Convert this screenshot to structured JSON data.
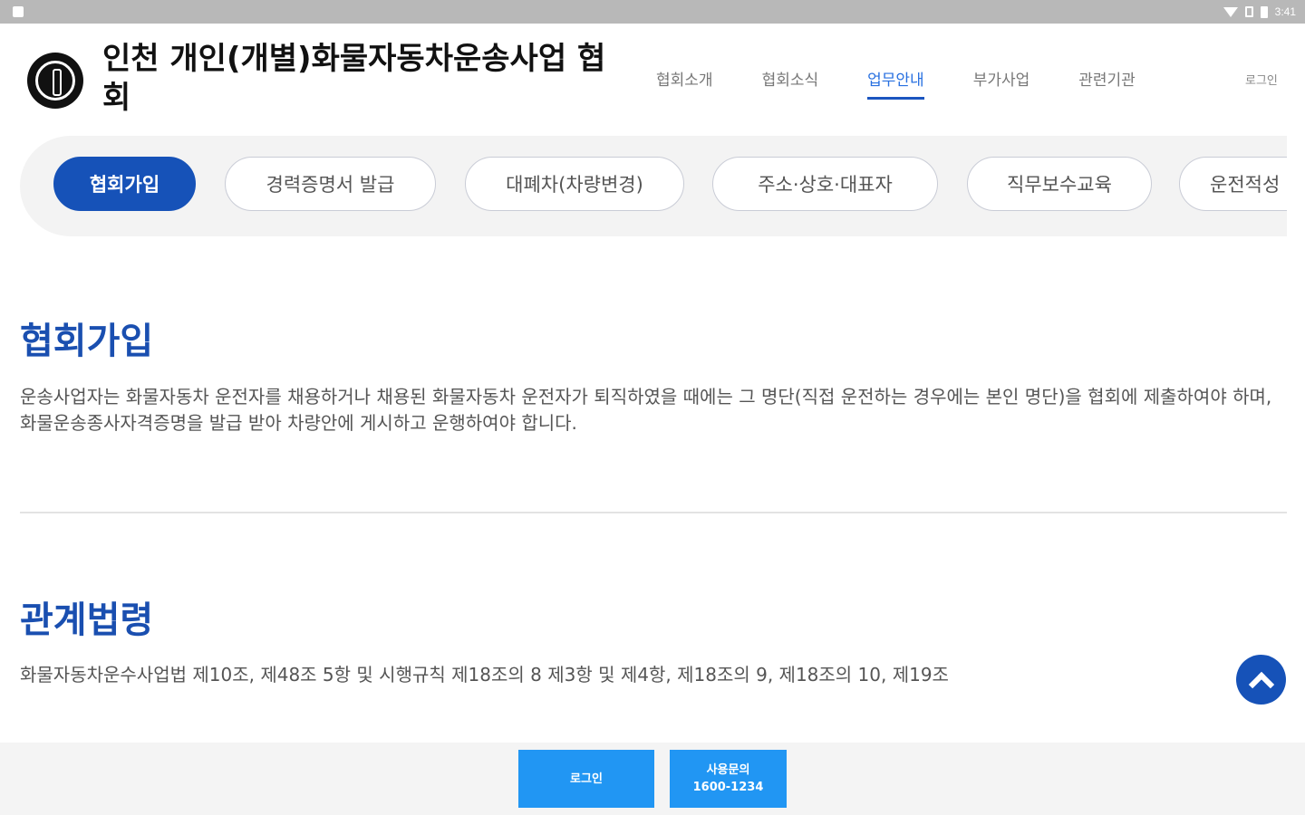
{
  "status_bar": {
    "time": "3:41"
  },
  "header": {
    "title": "인천 개인(개별)화물자동차운송사업 협회",
    "nav": [
      {
        "label": "협회소개"
      },
      {
        "label": "협회소식"
      },
      {
        "label": "업무안내"
      },
      {
        "label": "부가사업"
      },
      {
        "label": "관련기관"
      }
    ],
    "login": "로그인"
  },
  "subtabs": [
    {
      "label": "협회가입"
    },
    {
      "label": "경력증명서 발급"
    },
    {
      "label": "대폐차(차량변경)"
    },
    {
      "label": "주소·상호·대표자"
    },
    {
      "label": "직무보수교육"
    },
    {
      "label": "운전적성"
    }
  ],
  "sections": [
    {
      "title": "협회가입",
      "body": "운송사업자는 화물자동차 운전자를 채용하거나 채용된 화물자동차 운전자가 퇴직하였을 때에는 그 명단(직접 운전하는 경우에는 본인 명단)을 협회에 제출하여야 하며, 화물운송종사자격증명을 발급 받아 차량안에 게시하고 운행하여야 합니다."
    },
    {
      "title": "관계법령",
      "body": "화물자동차운수사업법 제10조, 제48조 5항 및 시행규칙 제18조의 8 제3항 및 제4항, 제18조의 9, 제18조의 10, 제19조"
    }
  ],
  "bottom_bar": {
    "login_label": "로그인",
    "inquiry_label": "사용문의",
    "inquiry_phone": "1600-1234"
  },
  "colors": {
    "primary": "#1652b8",
    "accent": "#2196f3",
    "nav_active": "#2870e0"
  }
}
